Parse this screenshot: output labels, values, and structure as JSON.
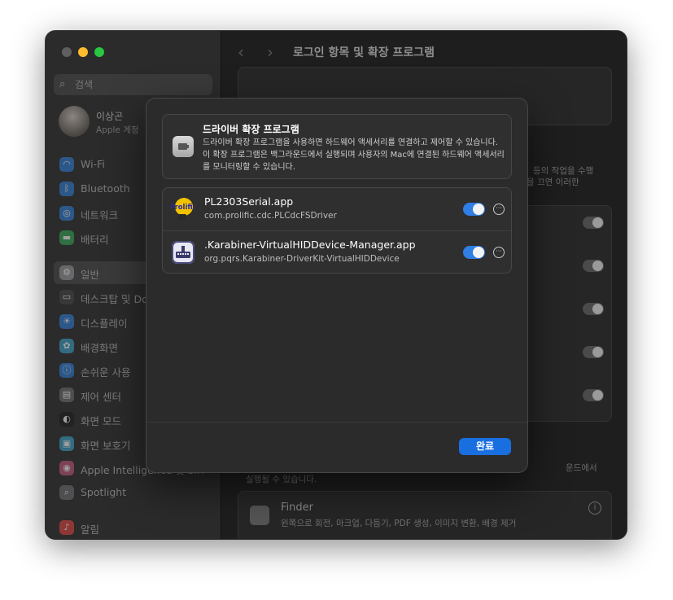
{
  "window": {
    "title": "로그인 항목 및 확장 프로그램",
    "traffic_colors": [
      "#5f5f5f",
      "#febc2e",
      "#28c840"
    ]
  },
  "sidebar": {
    "search_placeholder": "검색",
    "profile": {
      "name": "이상곤",
      "subtitle": "Apple 계정"
    },
    "items": [
      {
        "label": "Wi-Fi",
        "icon": "wifi-icon",
        "color": "#2e7dd7"
      },
      {
        "label": "Bluetooth",
        "icon": "bluetooth-icon",
        "color": "#2e7dd7"
      },
      {
        "label": "네트워크",
        "icon": "globe-icon",
        "color": "#2e7dd7"
      },
      {
        "label": "배터리",
        "icon": "battery-icon",
        "color": "#34a853"
      },
      {
        "label": "일반",
        "icon": "gear-icon",
        "color": "#8e8e93",
        "selected": true
      },
      {
        "label": "데스크탑 및 Dock",
        "icon": "dock-icon",
        "color": "#444444"
      },
      {
        "label": "디스플레이",
        "icon": "sun-icon",
        "color": "#2e7dd7"
      },
      {
        "label": "배경화면",
        "icon": "flower-icon",
        "color": "#3aa1c8"
      },
      {
        "label": "손쉬운 사용",
        "icon": "accessibility-icon",
        "color": "#2e7dd7"
      },
      {
        "label": "제어 센터",
        "icon": "control-center-icon",
        "color": "#6e6e73"
      },
      {
        "label": "화면 모드",
        "icon": "appearance-icon",
        "color": "#1c1c1e"
      },
      {
        "label": "화면 보호기",
        "icon": "screensaver-icon",
        "color": "#3aa1c8"
      },
      {
        "label": "Apple Intelligence 및 Siri",
        "icon": "siri-icon",
        "color": "#c2567a"
      },
      {
        "label": "Spotlight",
        "icon": "search-icon",
        "color": "#6e6e73"
      },
      {
        "label": "알림",
        "icon": "bell-icon",
        "color": "#e0443e"
      }
    ]
  },
  "background": {
    "side_text_1": "등의 작업을 수행",
    "side_text_2": "을 끄면 이러한",
    "bottom_text_1": "실행될 수 있습니다.",
    "bottom_text_2": "운드에서",
    "finder_title": "Finder",
    "finder_desc": "왼쪽으로 회전, 마크업, 다듬기, PDF 생성, 이미지 변환, 배경 제거"
  },
  "sheet": {
    "info": {
      "title": "드라이버 확장 프로그램",
      "description": "드라이버 확장 프로그램을 사용하면 하드웨어 액세서리를 연결하고 제어할 수 있습니다. 이 확장 프로그램은 백그라운드에서 실행되며 사용자의 Mac에 연결된 하드웨어 액세서리를 모니터링할 수 있습니다."
    },
    "extensions": [
      {
        "name": "PL2303Serial.app",
        "bundle_id": "com.prolific.cdc.PLCdcFSDriver",
        "enabled": true,
        "icon": "prolific-icon",
        "icon_text": "Prolific"
      },
      {
        "name": ".Karabiner-VirtualHIDDevice-Manager.app",
        "bundle_id": "org.pqrs.Karabiner-DriverKit-VirtualHIDDevice",
        "enabled": true,
        "icon": "karabiner-icon"
      }
    ],
    "done_label": "완료",
    "accent": "#1a6fe0"
  }
}
